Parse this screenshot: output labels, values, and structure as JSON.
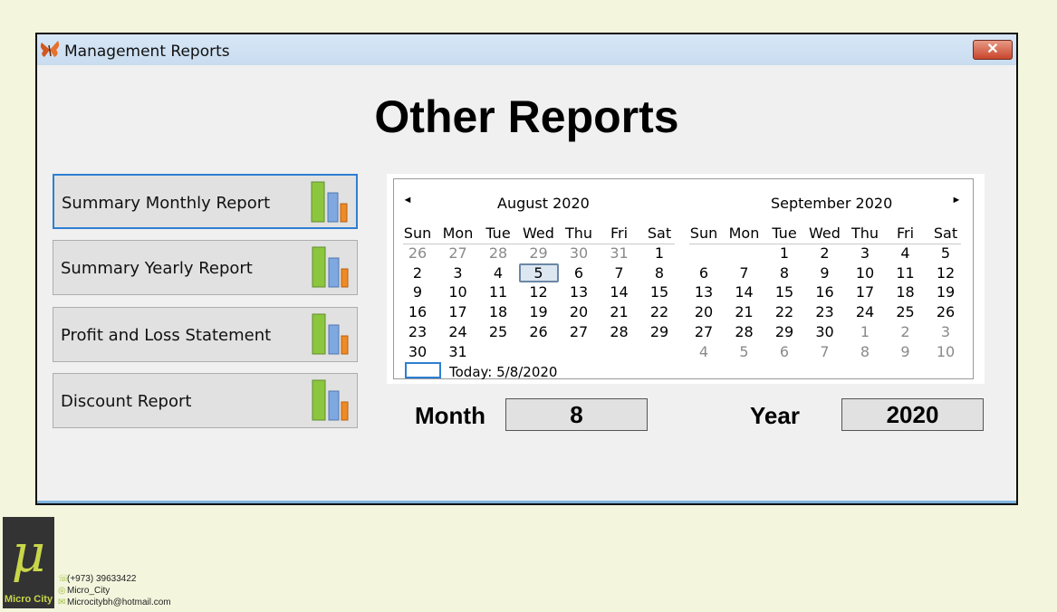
{
  "window": {
    "title": "Management Reports",
    "close_label": "✕"
  },
  "page_title": "Other Reports",
  "reports": [
    {
      "label": "Summary Monthly Report"
    },
    {
      "label": "Summary Yearly Report"
    },
    {
      "label": "Profit and Loss Statement"
    },
    {
      "label": "Discount Report"
    }
  ],
  "calendar": {
    "prev_label": "◄",
    "next_label": "►",
    "weekdays": [
      "Sun",
      "Mon",
      "Tue",
      "Wed",
      "Thu",
      "Fri",
      "Sat"
    ],
    "months": [
      {
        "title": "August 2020",
        "weeks": [
          [
            "26",
            "27",
            "28",
            "29",
            "30",
            "31",
            "1"
          ],
          [
            "2",
            "3",
            "4",
            "5",
            "6",
            "7",
            "8"
          ],
          [
            "9",
            "10",
            "11",
            "12",
            "13",
            "14",
            "15"
          ],
          [
            "16",
            "17",
            "18",
            "19",
            "20",
            "21",
            "22"
          ],
          [
            "23",
            "24",
            "25",
            "26",
            "27",
            "28",
            "29"
          ],
          [
            "30",
            "31",
            "",
            "",
            "",
            "",
            ""
          ]
        ],
        "dim_prefix_count": 6,
        "selected": "5"
      },
      {
        "title": "September 2020",
        "weeks": [
          [
            "",
            "",
            "1",
            "2",
            "3",
            "4",
            "5"
          ],
          [
            "6",
            "7",
            "8",
            "9",
            "10",
            "11",
            "12"
          ],
          [
            "13",
            "14",
            "15",
            "16",
            "17",
            "18",
            "19"
          ],
          [
            "20",
            "21",
            "22",
            "23",
            "24",
            "25",
            "26"
          ],
          [
            "27",
            "28",
            "29",
            "30",
            "1",
            "2",
            "3"
          ],
          [
            "4",
            "5",
            "6",
            "7",
            "8",
            "9",
            "10"
          ]
        ],
        "dim_suffix_from": "1"
      }
    ],
    "today_text": "Today: 5/8/2020"
  },
  "month_field": {
    "label": "Month",
    "value": "8"
  },
  "year_field": {
    "label": "Year",
    "value": "2020"
  },
  "footer": {
    "brand_symbol": "μ",
    "brand": "Micro City",
    "phone": "(+973) 39633422",
    "instagram": "Micro_City",
    "email": "Microcitybh@hotmail.com"
  },
  "colors": {
    "focus_blue": "#2e7fd2",
    "close_red": "#c9462c",
    "background": "#f3f6dd"
  },
  "icons": [
    "butterfly-app-icon",
    "bar-chart-icon",
    "close-icon",
    "whatsapp-icon",
    "instagram-icon",
    "email-icon"
  ]
}
